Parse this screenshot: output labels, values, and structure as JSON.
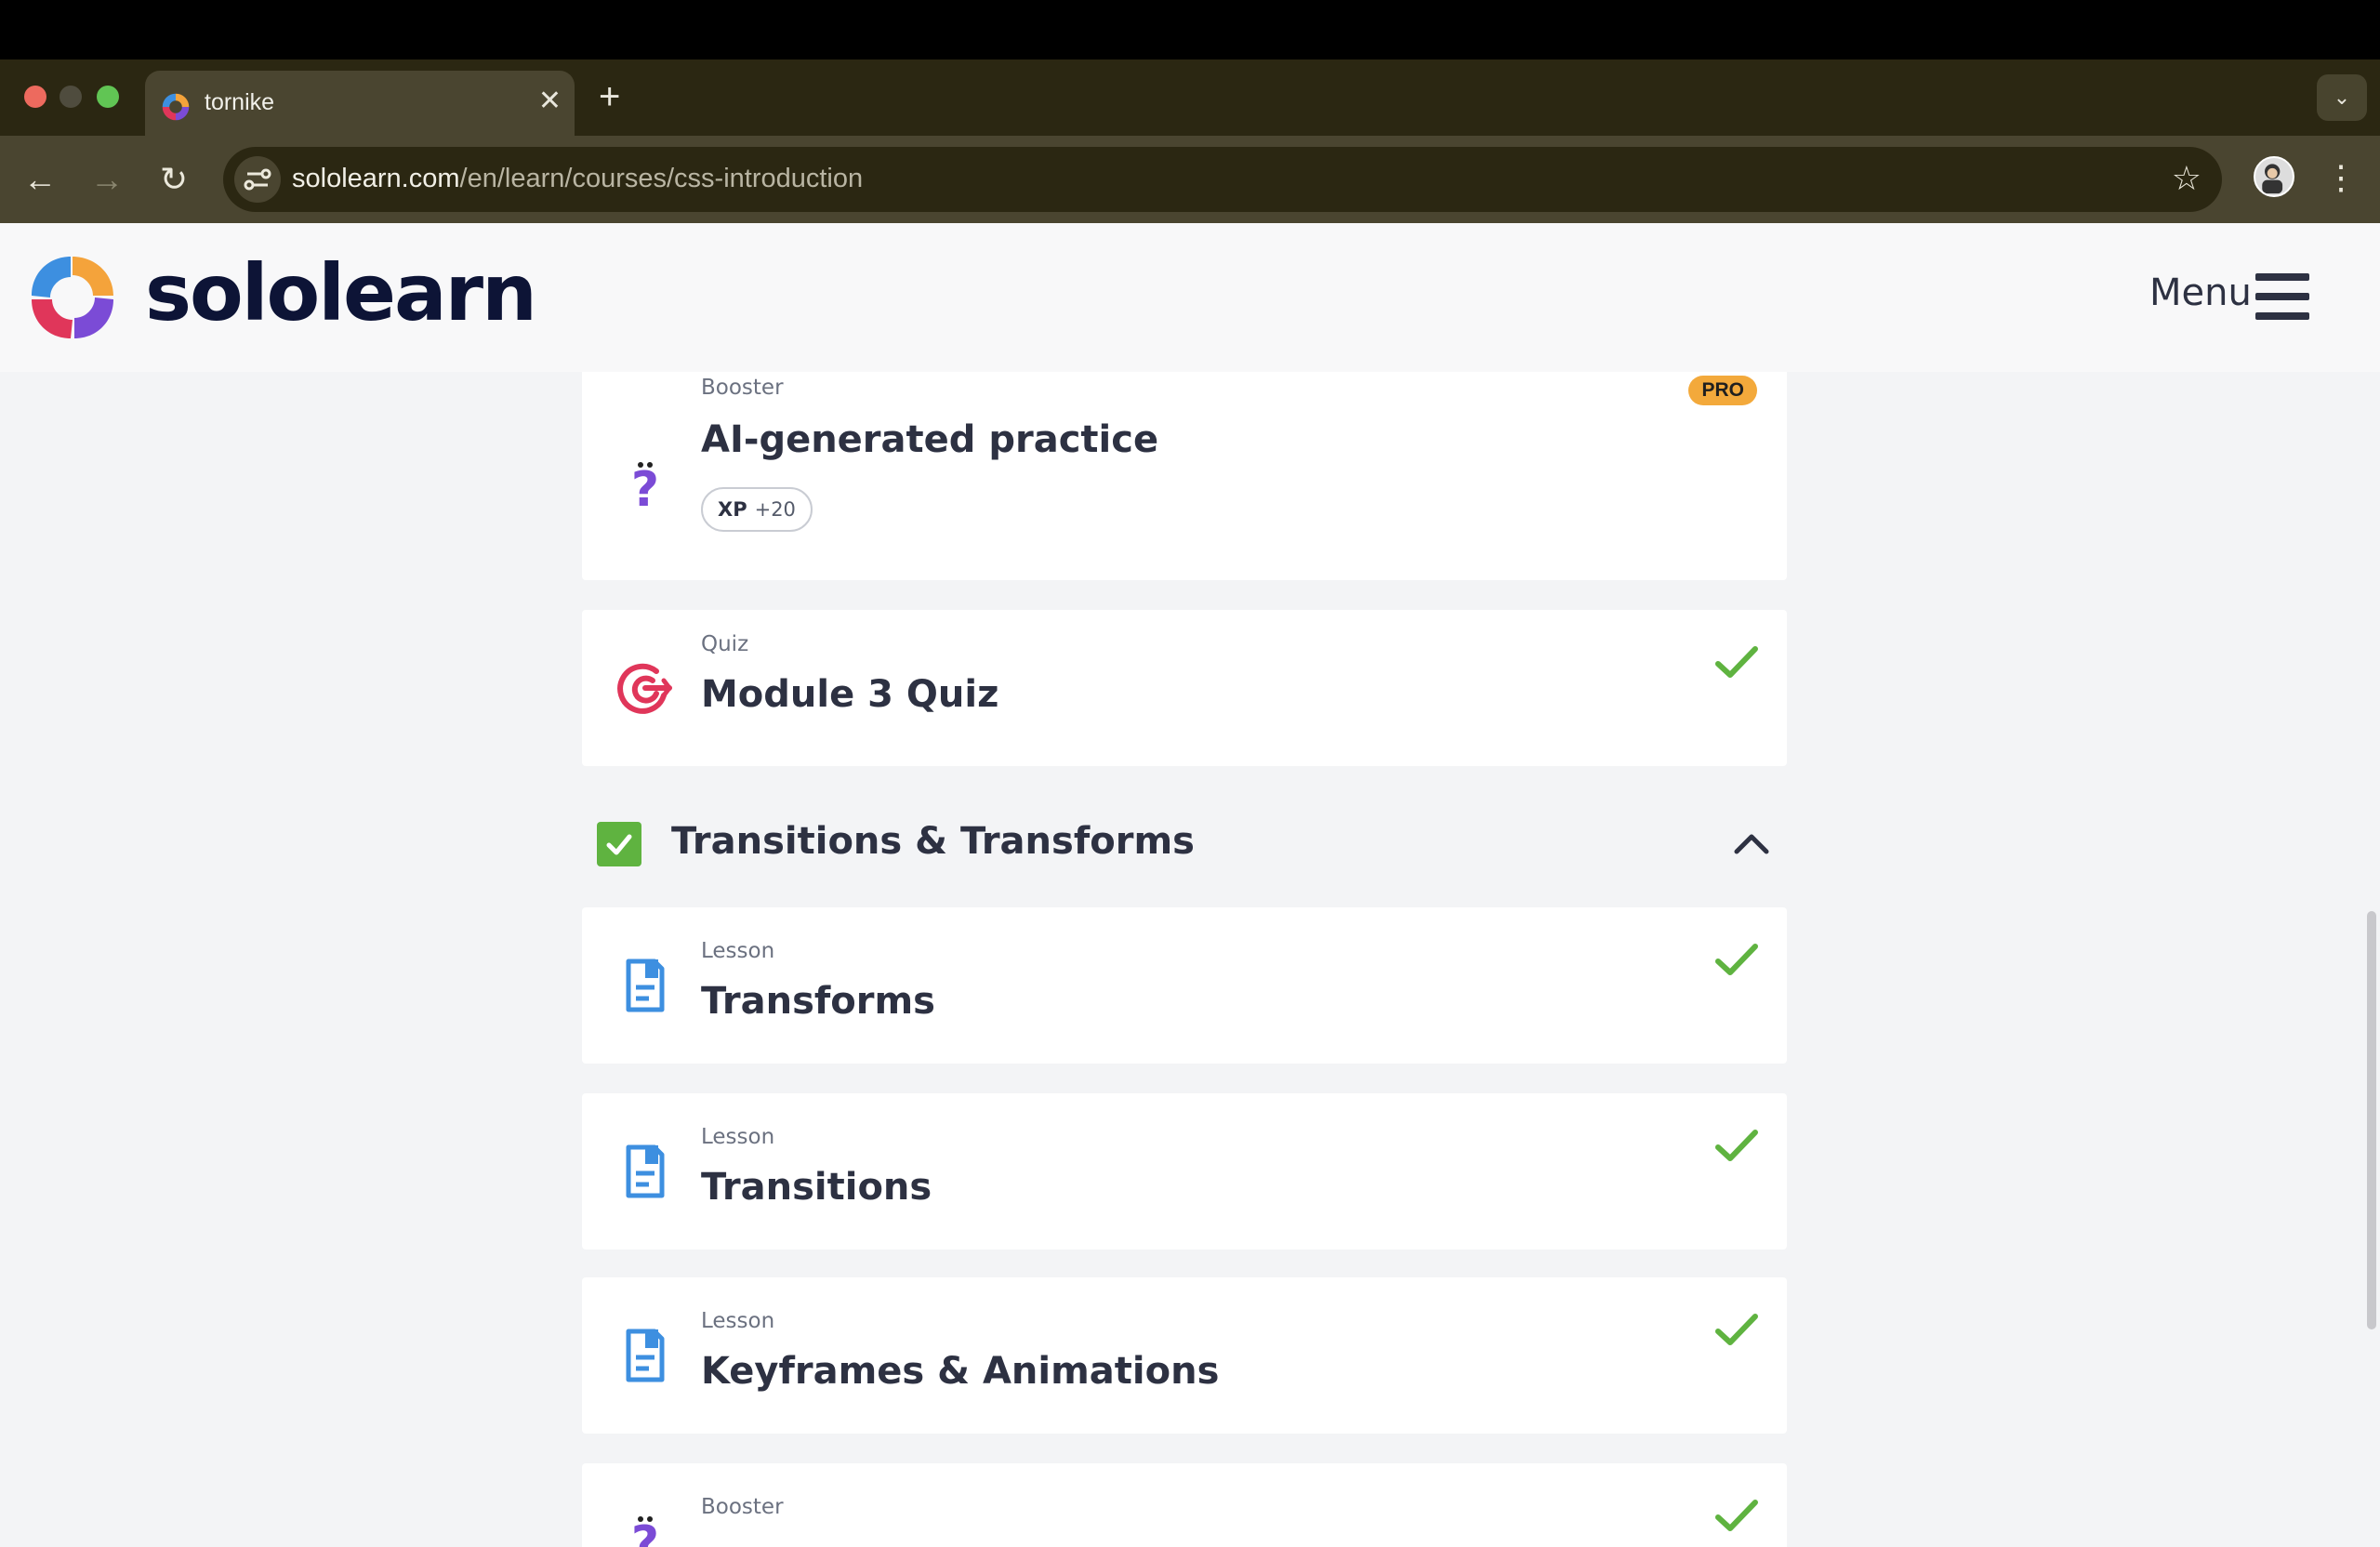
{
  "browser": {
    "tab_title": "tornike",
    "url_host": "sololearn.com",
    "url_path": "/en/learn/courses/css-introduction"
  },
  "header": {
    "brand": "sololearn",
    "menu_label": "Menu"
  },
  "items": [
    {
      "kind": "Booster",
      "title": "AI-generated practice",
      "badge": "PRO",
      "xp_label": "XP",
      "xp_value": "+20",
      "icon": "question-mascot-icon"
    },
    {
      "kind": "Quiz",
      "title": "Module 3 Quiz",
      "completed": true,
      "icon": "target-icon"
    }
  ],
  "section": {
    "title": "Transitions & Transforms",
    "completed": true
  },
  "lessons": [
    {
      "kind": "Lesson",
      "title": "Transforms",
      "completed": true,
      "icon": "lesson-document-icon"
    },
    {
      "kind": "Lesson",
      "title": "Transitions",
      "completed": true,
      "icon": "lesson-document-icon"
    },
    {
      "kind": "Lesson",
      "title": "Keyframes & Animations",
      "completed": true,
      "icon": "lesson-document-icon"
    },
    {
      "kind": "Booster",
      "title": "",
      "completed": true,
      "icon": "question-mascot-icon"
    }
  ],
  "colors": {
    "check_green": "#5fb340",
    "pro_orange": "#f3a93b",
    "lesson_blue": "#3d8fe0",
    "quiz_red": "#e0365a",
    "booster_purple": "#7b4bd6"
  }
}
